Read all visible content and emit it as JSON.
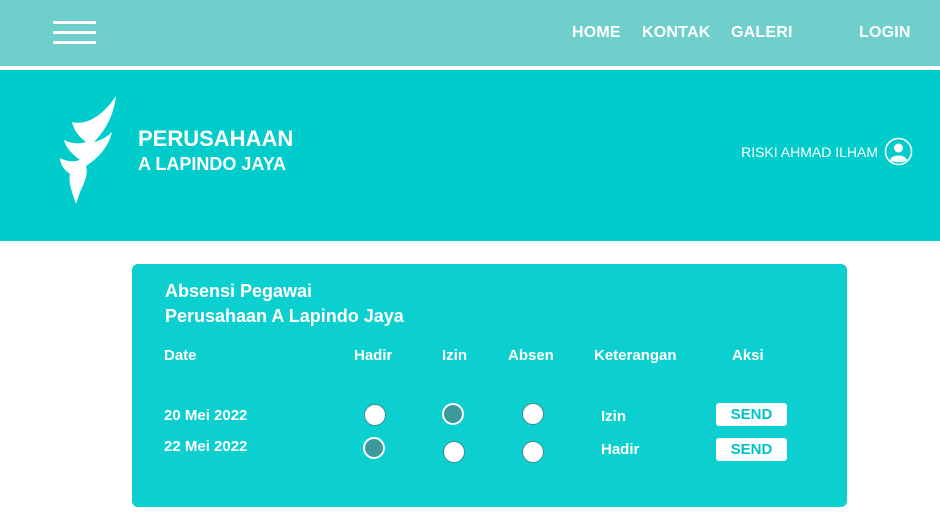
{
  "nav": {
    "menu_icon": "hamburger-icon",
    "links": [
      "HOME",
      "KONTAK",
      "GALERI"
    ],
    "login": "LOGIN"
  },
  "header": {
    "logo_icon": "wing-logo-icon",
    "company_line1": "PERUSAHAAN",
    "company_line2": "A LAPINDO JAYA",
    "user_name": "RISKI AHMAD ILHAM",
    "user_icon": "user-avatar-icon"
  },
  "attendance": {
    "title_line1": "Absensi Pegawai",
    "title_line2": "Perusahaan A Lapindo Jaya",
    "columns": [
      "Date",
      "Hadir",
      "Izin",
      "Absen",
      "Keterangan",
      "Aksi"
    ],
    "rows": [
      {
        "date": "20 Mei 2022",
        "selected": "Izin",
        "keterangan": "Izin",
        "action": "SEND"
      },
      {
        "date": "22 Mei 2022",
        "selected": "Hadir",
        "keterangan": "Hadir",
        "action": "SEND"
      }
    ]
  },
  "colors": {
    "topbar": "#6ecfcb",
    "header": "#00cccc",
    "card": "#0ccfcf",
    "radio_selected": "#3c9a9a"
  }
}
